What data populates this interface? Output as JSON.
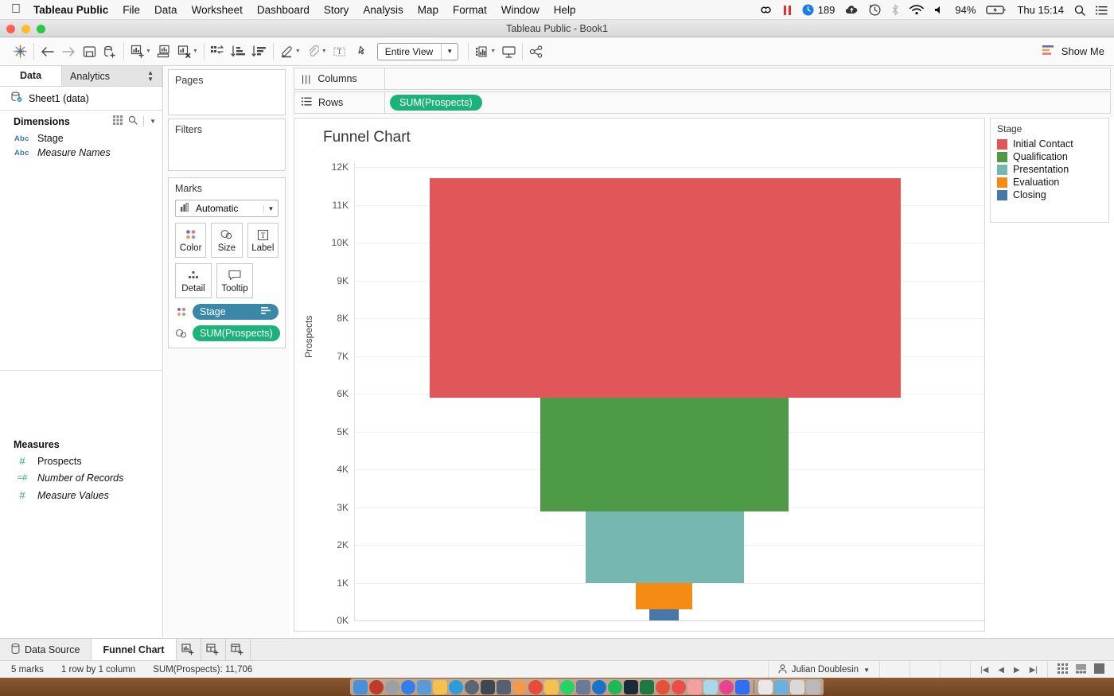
{
  "menubar": {
    "apple_icon": "apple-logo-icon",
    "app_name": "Tableau Public",
    "items": [
      "File",
      "Data",
      "Worksheet",
      "Dashboard",
      "Story",
      "Analysis",
      "Map",
      "Format",
      "Window",
      "Help"
    ],
    "status_items": {
      "creative_cloud_icon": "creative-cloud-icon",
      "pause_icon": "pause-icon",
      "clock_blue_icon": "blue-clock-icon",
      "count": "189",
      "upload_icon": "cloud-upload-icon",
      "timemachine_icon": "time-machine-icon",
      "bluetooth_icon": "bluetooth-icon",
      "wifi_icon": "wifi-icon",
      "volume_icon": "volume-icon",
      "battery_percent": "94%",
      "battery_icon": "battery-charging-icon",
      "clock": "Thu 15:14",
      "search_icon": "spotlight-search-icon",
      "menu_icon": "notification-center-icon"
    }
  },
  "window": {
    "title": "Tableau Public - Book1"
  },
  "toolbar": {
    "logo": "tableau-logo-icon",
    "back": "back-arrow-icon",
    "forward": "forward-arrow-icon",
    "save": "save-icon",
    "new_data_source": "new-data-source-icon",
    "new_worksheet": "new-worksheet-icon",
    "duplicate_sheet": "duplicate-sheet-icon",
    "clear_sheet": "clear-sheet-icon",
    "swap_axes": "swap-rows-columns-icon",
    "sort_asc": "sort-ascending-icon",
    "sort_desc": "sort-descending-icon",
    "highlight": "highlight-icon",
    "group": "group-members-icon",
    "labels": "show-mark-labels-icon",
    "fix_axes": "fix-axes-icon",
    "fit": "Entire View",
    "presentation_fit": "fit-dropdown-icon",
    "presentation_mode": "presentation-mode-icon",
    "share": "share-icon",
    "show_me": "Show Me",
    "show_me_icon": "show-me-icon"
  },
  "data_pane": {
    "tabs": [
      {
        "label": "Data",
        "active": true
      },
      {
        "label": "Analytics",
        "active": false
      }
    ],
    "data_source": {
      "label": "Sheet1 (data)",
      "icon": "data-source-icon"
    },
    "dimensions": {
      "header": "Dimensions",
      "grid_icon": "grid-view-icon",
      "search_icon": "search-icon",
      "caret_icon": "chevron-down-icon",
      "fields": [
        {
          "name": "Stage",
          "type": "Abc",
          "italic": false
        },
        {
          "name": "Measure Names",
          "type": "Abc",
          "italic": true
        }
      ]
    },
    "measures": {
      "header": "Measures",
      "fields": [
        {
          "name": "Prospects",
          "type": "#",
          "italic": false
        },
        {
          "name": "Number of Records",
          "type": "=#",
          "italic": true
        },
        {
          "name": "Measure Values",
          "type": "#",
          "italic": true
        }
      ]
    }
  },
  "shelf_column": {
    "pages": {
      "title": "Pages"
    },
    "filters": {
      "title": "Filters"
    },
    "marks": {
      "title": "Marks",
      "mark_type": "Automatic",
      "mark_type_icon": "bar-mark-icon",
      "buttons": [
        {
          "label": "Color",
          "icon": "color-palette-icon"
        },
        {
          "label": "Size",
          "icon": "size-icon"
        },
        {
          "label": "Label",
          "icon": "label-icon"
        },
        {
          "label": "Detail",
          "icon": "detail-icon"
        },
        {
          "label": "Tooltip",
          "icon": "tooltip-icon"
        }
      ],
      "pills": [
        {
          "label": "Stage",
          "color": "#3a87a8",
          "icon": "color-palette-icon",
          "sort_icon": "sort-icon"
        },
        {
          "label": "SUM(Prospects)",
          "color": "#1cb37a",
          "icon": "size-icon",
          "sort_icon": ""
        }
      ]
    }
  },
  "shelves": {
    "columns": {
      "label": "Columns",
      "icon": "columns-icon",
      "pills": []
    },
    "rows": {
      "label": "Rows",
      "icon": "rows-icon",
      "pills": [
        "SUM(Prospects)"
      ]
    }
  },
  "legend": {
    "title": "Stage",
    "items": [
      {
        "label": "Initial Contact",
        "color": "#e15759"
      },
      {
        "label": "Qualification",
        "color": "#4e9a46"
      },
      {
        "label": "Presentation",
        "color": "#76b7b2"
      },
      {
        "label": "Evaluation",
        "color": "#f58b13"
      },
      {
        "label": "Closing",
        "color": "#4878a8"
      }
    ]
  },
  "chart_data": {
    "type": "bar",
    "title": "Funnel Chart",
    "xlabel": "",
    "ylabel": "Prospects",
    "ylim": [
      0,
      12000
    ],
    "yticks": [
      "12K",
      "11K",
      "10K",
      "9K",
      "8K",
      "7K",
      "6K",
      "5K",
      "4K",
      "3K",
      "2K",
      "1K",
      "0K"
    ],
    "ytick_values": [
      12000,
      11000,
      10000,
      9000,
      8000,
      7000,
      6000,
      5000,
      4000,
      3000,
      2000,
      1000,
      0
    ],
    "grid": true,
    "legend_position": "right",
    "categories": [
      "Initial Contact",
      "Qualification",
      "Presentation",
      "Evaluation",
      "Closing"
    ],
    "values": [
      5800,
      3000,
      1900,
      700,
      306
    ],
    "series": [
      {
        "name": "Initial Contact",
        "top": 11700,
        "bottom": 5900,
        "value": 5800,
        "color": "#e15759"
      },
      {
        "name": "Qualification",
        "top": 5900,
        "bottom": 2900,
        "value": 3000,
        "color": "#4e9a46"
      },
      {
        "name": "Presentation",
        "top": 2900,
        "bottom": 1000,
        "value": 1900,
        "color": "#76b7b2"
      },
      {
        "name": "Evaluation",
        "top": 1000,
        "bottom": 300,
        "value": 700,
        "color": "#f58b13"
      },
      {
        "name": "Closing",
        "top": 300,
        "bottom": 0,
        "value": 300,
        "color": "#4878a8"
      }
    ],
    "total": 11706
  },
  "bottom_tabs": {
    "data_source": {
      "label": "Data Source",
      "icon": "data-source-tab-icon"
    },
    "sheets": [
      {
        "label": "Funnel Chart",
        "active": true
      }
    ],
    "new_sheet_icon": "new-worksheet-icon",
    "new_dashboard_icon": "new-dashboard-icon",
    "new_story_icon": "new-story-icon"
  },
  "status_bar": {
    "marks": "5 marks",
    "rows_cols": "1 row by 1 column",
    "sum": "SUM(Prospects): 11,706",
    "user": "Julian Doublesin",
    "user_icon": "user-avatar-icon",
    "caret_icon": "chevron-down-icon",
    "nav": [
      "first-page-icon",
      "prev-page-icon",
      "next-page-icon",
      "last-page-icon"
    ],
    "views": [
      "grid-view-icon",
      "filmstrip-view-icon",
      "single-view-icon"
    ]
  },
  "dock": {
    "icons": [
      "#4a90d9",
      "#c0392b",
      "#9aa0a6",
      "#2f80ed",
      "#5b9bd5",
      "#f2c14e",
      "#2d9cdb",
      "#5a6672",
      "#3d4852",
      "#556070",
      "#f2994a",
      "#e84b3a",
      "#f2c14e",
      "#25d366",
      "#6b7a99",
      "#1a73c9",
      "#1db954",
      "#1c2a3a",
      "#1e7a44",
      "#e55039",
      "#eb4d4b",
      "#45aaf2",
      "#e84393",
      "#f5f5f5",
      "#2d6ff7",
      "#2f80ed"
    ],
    "trailing": [
      "#e8e8e8",
      "#6ab0de",
      "#d9d9d9",
      "#b9b9b9"
    ]
  }
}
